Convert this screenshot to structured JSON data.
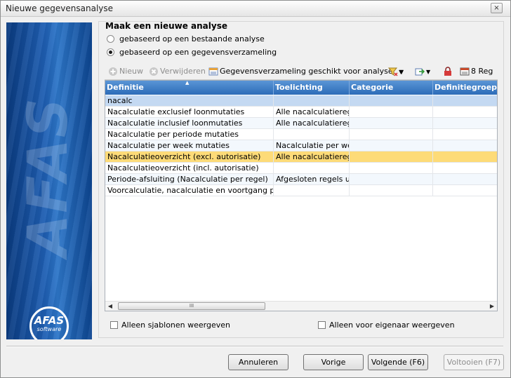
{
  "window": {
    "title": "Nieuwe gegevensanalyse",
    "close_label": "×"
  },
  "sidebar": {
    "brand_word": "AFAS",
    "logo_line1": "AFAS",
    "logo_line2": "software"
  },
  "section": {
    "heading": "Maak een nieuwe analyse"
  },
  "options": [
    {
      "label": "gebaseerd op een bestaande analyse",
      "selected": false
    },
    {
      "label": "gebaseerd op een gegevensverzameling",
      "selected": true
    }
  ],
  "toolbar": {
    "new_label": "Nieuw",
    "delete_label": "Verwijderen",
    "dataset_label": "Gegevensverzameling geschikt voor analyse",
    "records_label": "8 Reg"
  },
  "grid": {
    "columns": [
      "Definitie",
      "Toelichting",
      "Categorie",
      "Definitiegroep"
    ],
    "filter_text": "nacalc",
    "rows": [
      [
        "Nacalculatie exclusief loonmutaties",
        "Alle nacalculatieregels",
        "",
        ""
      ],
      [
        "Nacalculatie inclusief loonmutaties",
        "Alle nacalculatieregels",
        "",
        ""
      ],
      [
        "Nacalculatie per periode mutaties",
        "",
        "",
        ""
      ],
      [
        "Nacalculatie per week mutaties",
        "Nacalculatie per week",
        "",
        ""
      ],
      [
        "Nacalculatieoverzicht (excl. autorisatie)",
        "Alle nacalculatieregels",
        "",
        ""
      ],
      [
        "Nacalculatieoverzicht (incl. autorisatie)",
        "",
        "",
        ""
      ],
      [
        "Periode-afsluiting (Nacalculatie per regel)",
        "Afgesloten regels uit N",
        "",
        ""
      ],
      [
        "Voorcalculatie, nacalculatie en voortgang per pro",
        "",
        "",
        ""
      ]
    ],
    "selected_row": 4,
    "scroll_grip": "III"
  },
  "checks": {
    "templates_only": "Alleen sjablonen weergeven",
    "owner_only": "Alleen voor eigenaar weergeven"
  },
  "buttons": {
    "cancel": "Annuleren",
    "previous": "Vorige",
    "next": "Volgende (F6)",
    "finish": "Voltooien (F7)"
  },
  "colors": {
    "selected_row": "#fddb78",
    "header": "#2c6cb8",
    "sidebar": "#1f5fb3"
  }
}
